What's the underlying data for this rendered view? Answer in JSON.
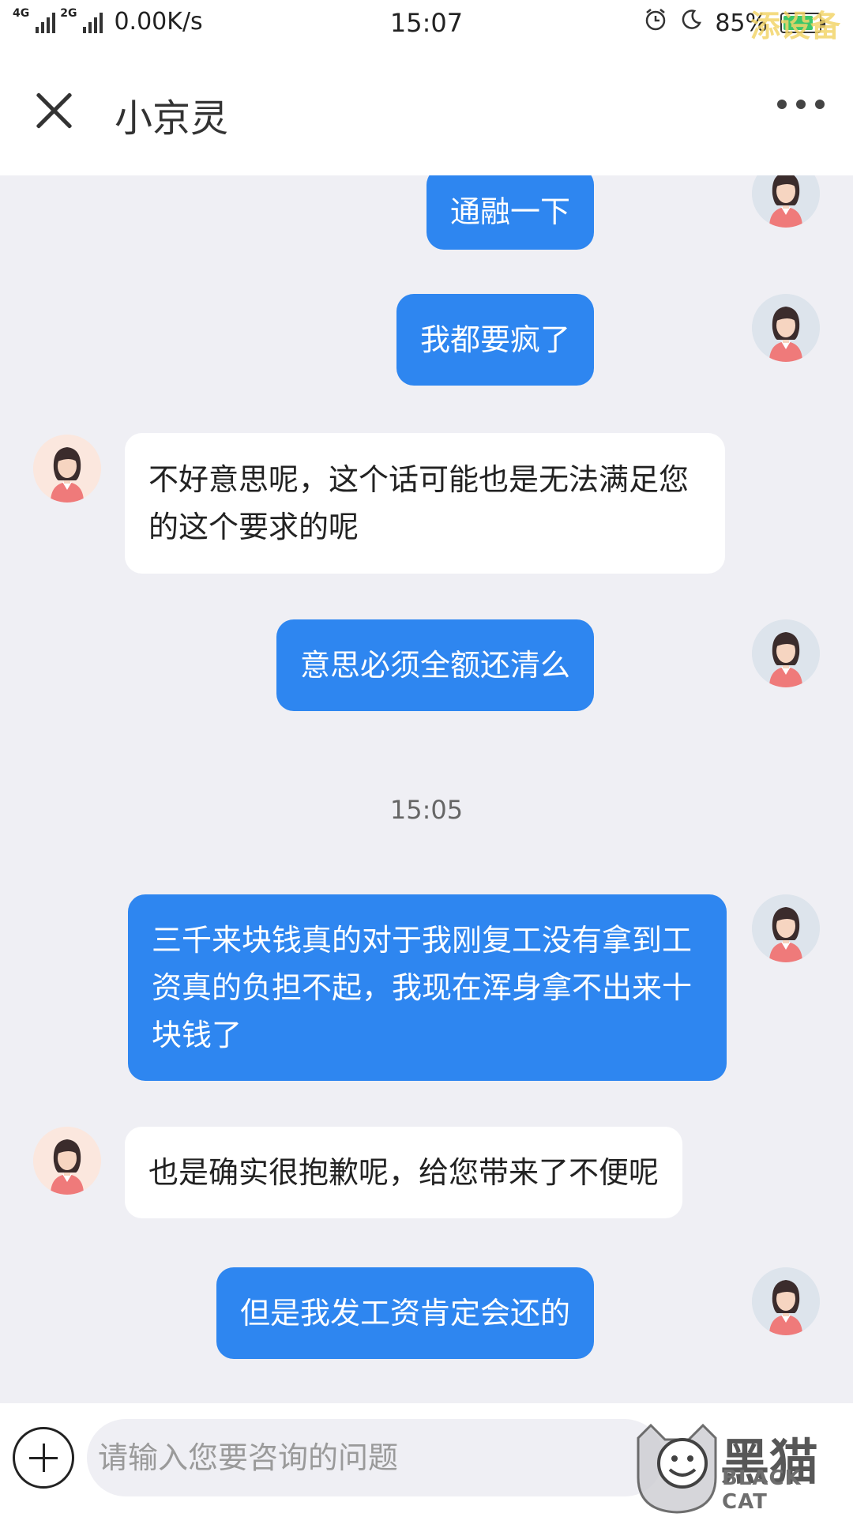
{
  "status_bar": {
    "network_1": "4G",
    "network_2": "4G",
    "network_3": "2G",
    "speed": "0.00K/s",
    "time": "15:07",
    "battery": "85%",
    "battery_level": 0.85,
    "watermark": "添设备"
  },
  "header": {
    "title": "小京灵"
  },
  "messages": [
    {
      "from": "user",
      "text": "通融一下"
    },
    {
      "from": "user",
      "text": "我都要疯了"
    },
    {
      "from": "bot",
      "text": "不好意思呢，这个话可能也是无法满足您的这个要求的呢"
    },
    {
      "from": "user",
      "text": "意思必须全额还清么"
    },
    {
      "from": "user",
      "text": "三千来块钱真的对于我刚复工没有拿到工资真的负担不起，我现在浑身拿不出来十块钱了"
    },
    {
      "from": "bot",
      "text": "也是确实很抱歉呢，给您带来了不便呢"
    },
    {
      "from": "user",
      "text": "但是我发工资肯定会还的"
    }
  ],
  "timestamp": "15:05",
  "input": {
    "placeholder": "请输入您要咨询的问题",
    "value": ""
  },
  "watermark": {
    "big": "黑猫",
    "small": "BLACK CAT"
  },
  "colors": {
    "accent": "#2e86f0",
    "background": "#efeff4"
  }
}
